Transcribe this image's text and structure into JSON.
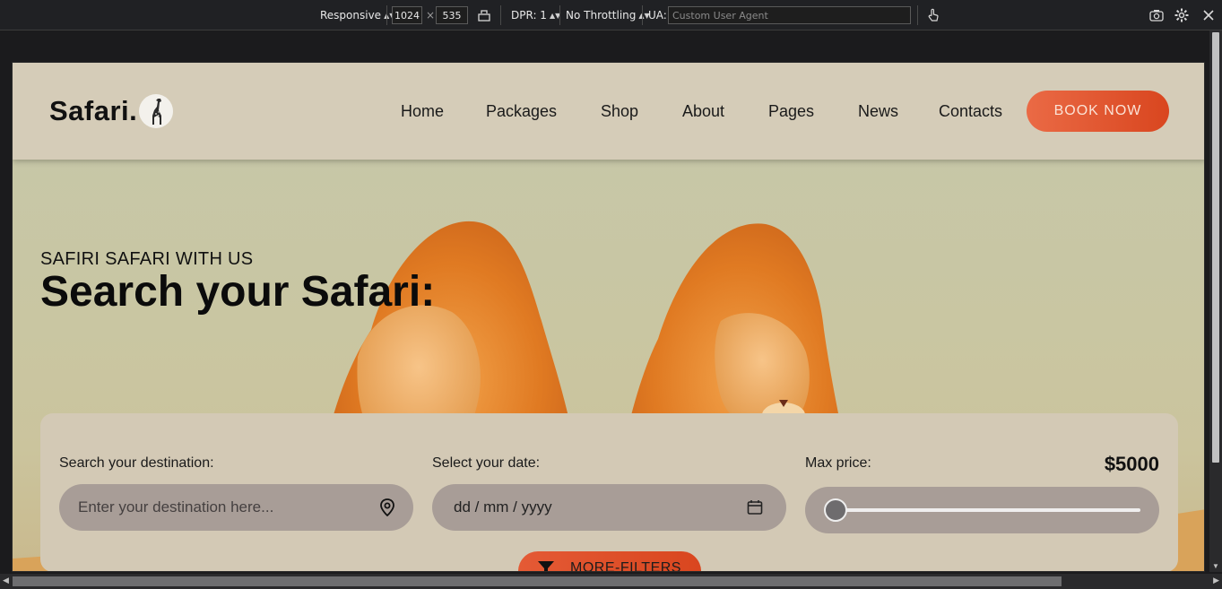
{
  "devtools": {
    "device_mode": "Responsive",
    "width": "1024",
    "times": "×",
    "height": "535",
    "dpr": "DPR: 1",
    "throttling": "No Throttling",
    "ua_label": "UA:",
    "ua_placeholder": "Custom User Agent"
  },
  "header": {
    "logo": "Safari.",
    "nav": [
      "Home",
      "Packages",
      "Shop",
      "About",
      "Pages",
      "News",
      "Contacts"
    ],
    "book_label": "BOOK NOW"
  },
  "hero": {
    "subtitle": "SAFIRI SAFARI WITH US",
    "title": "Search your Safari:"
  },
  "search": {
    "destination_label": "Search your destination:",
    "destination_placeholder": "Enter your destination here...",
    "date_label": "Select your date:",
    "date_placeholder": "dd / mm / yyyy",
    "price_label": "Max price:",
    "price_value": "$5000",
    "price_slider_fraction": 0.0,
    "filters_label": "MORE-FILTERS"
  },
  "colors": {
    "accent": "#e45a35",
    "header_bg": "#d5ccb8",
    "panel_bg": "#d3c9b5",
    "field_bg": "#a89d97"
  }
}
